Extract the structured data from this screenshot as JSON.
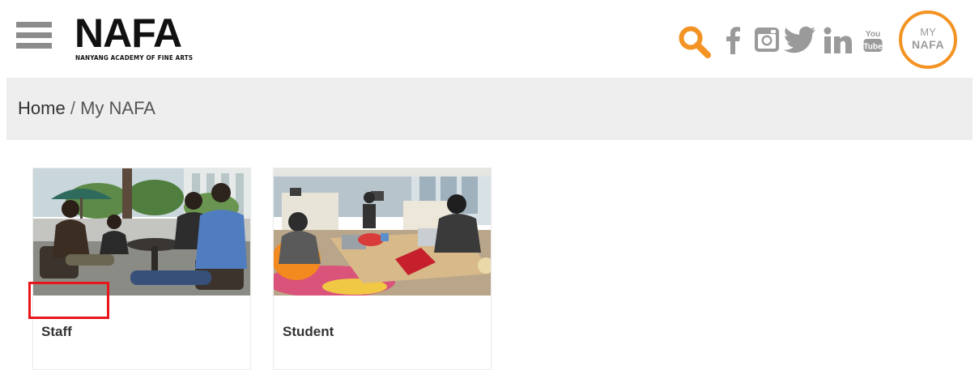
{
  "header": {
    "logo": {
      "wordmark": "NAFA",
      "tagline": "NANYANG ACADEMY OF FINE ARTS"
    },
    "icons": [
      "menu-icon",
      "search-icon",
      "facebook-icon",
      "instagram-icon",
      "twitter-icon",
      "linkedin-icon",
      "youtube-icon"
    ],
    "youtube_text": {
      "top": "You",
      "bottom": "Tube"
    },
    "my_nafa_badge": {
      "line1": "MY",
      "line2": "NAFA"
    }
  },
  "breadcrumb": {
    "home": "Home",
    "separator": "/",
    "current": "My NAFA"
  },
  "cards": [
    {
      "label": "Staff",
      "image": "staff-photo"
    },
    {
      "label": "Student",
      "image": "student-photo"
    }
  ],
  "colors": {
    "accent_orange": "#f39323",
    "icon_gray": "#9a9a9a",
    "breadcrumb_bg": "#eeeeee",
    "highlight_red": "#e8161b"
  }
}
